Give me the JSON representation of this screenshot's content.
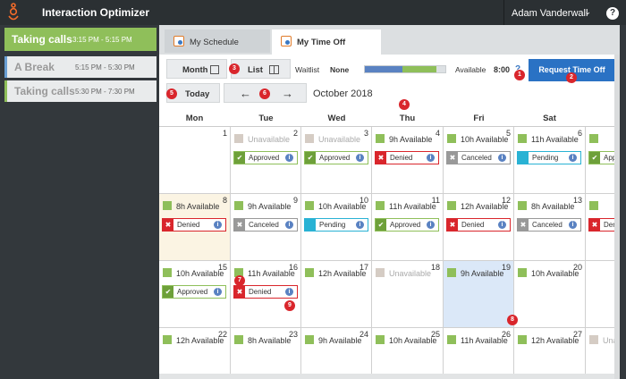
{
  "app": {
    "title": "Interaction Optimizer",
    "user": "Adam Vanderwall",
    "help": "?"
  },
  "sidebar": {
    "shifts": [
      {
        "name": "Taking calls",
        "time": "3:15 PM - 5:15 PM"
      },
      {
        "name": "A Break",
        "time": "5:15 PM - 5:30 PM"
      },
      {
        "name": "Taking calls",
        "time": "5:30 PM - 7:30 PM"
      }
    ]
  },
  "tabs": [
    {
      "label": "My Schedule"
    },
    {
      "label": "My Time Off"
    }
  ],
  "toolbar": {
    "month_label": "Month",
    "list_label": "List",
    "today_label": "Today",
    "prev_icon": "arrow-left-icon",
    "next_icon": "arrow-right-icon",
    "prev_glyph": "←",
    "next_glyph": "→",
    "current_month": "October 2018",
    "waitlist_label": "Waitlist",
    "waitlist_value": "None",
    "available_label": "Available",
    "available_value": "8:00",
    "help_glyph": "?",
    "request_button": "Request Time Off",
    "progress": {
      "blue_fraction": 0.47,
      "green_fraction": 0.42
    }
  },
  "badges": [
    "1",
    "2",
    "3",
    "4",
    "5",
    "6",
    "7",
    "8",
    "9"
  ],
  "calendar": {
    "days": [
      "Mon",
      "Tue",
      "Wed",
      "Thu",
      "Fri",
      "Sat",
      "Su"
    ],
    "weeks": [
      [
        {
          "day": "1",
          "avail": "",
          "status": ""
        },
        {
          "day": "2",
          "avail": "Unavailable",
          "unavailable": true,
          "status": "Approved"
        },
        {
          "day": "3",
          "avail": "Unavailable",
          "unavailable": true,
          "status": "Approved"
        },
        {
          "day": "4",
          "avail": "9h Available",
          "status": "Denied"
        },
        {
          "day": "5",
          "avail": "10h Available",
          "status": "Canceled"
        },
        {
          "day": "6",
          "avail": "11h Available",
          "status": "Pending"
        },
        {
          "day": "",
          "avail": "",
          "status": "Approved"
        }
      ],
      [
        {
          "day": "8",
          "avail": "8h Available",
          "status": "Denied",
          "today": true
        },
        {
          "day": "9",
          "avail": "9h Available",
          "status": "Canceled"
        },
        {
          "day": "10",
          "avail": "10h Available",
          "status": "Pending"
        },
        {
          "day": "11",
          "avail": "11h Available",
          "status": "Approved"
        },
        {
          "day": "12",
          "avail": "12h Available",
          "status": "Denied"
        },
        {
          "day": "13",
          "avail": "8h Available",
          "status": "Canceled"
        },
        {
          "day": "",
          "avail": "",
          "status": "Denied"
        }
      ],
      [
        {
          "day": "15",
          "avail": "10h Available",
          "status": "Approved"
        },
        {
          "day": "16",
          "avail": "11h Available",
          "status": "Denied"
        },
        {
          "day": "17",
          "avail": "12h Available",
          "status": ""
        },
        {
          "day": "18",
          "avail": "Unavailable",
          "unavailable": true,
          "status": ""
        },
        {
          "day": "19",
          "avail": "9h Available",
          "status": "",
          "selected": true
        },
        {
          "day": "20",
          "avail": "10h Available",
          "status": ""
        },
        {
          "day": "",
          "avail": "",
          "status": ""
        }
      ],
      [
        {
          "day": "22",
          "avail": "12h Available",
          "status": ""
        },
        {
          "day": "23",
          "avail": "8h Available",
          "status": ""
        },
        {
          "day": "24",
          "avail": "9h Available",
          "status": ""
        },
        {
          "day": "25",
          "avail": "10h Available",
          "status": ""
        },
        {
          "day": "26",
          "avail": "11h Available",
          "status": ""
        },
        {
          "day": "27",
          "avail": "12h Available",
          "status": ""
        },
        {
          "day": "",
          "avail": "Unav",
          "unavailable": true,
          "status": ""
        }
      ]
    ]
  },
  "colors": {
    "accent": "#2a72c4",
    "available": "#8fbf5a",
    "denied": "#d9262c",
    "pending": "#29b2d4",
    "canceled": "#999999",
    "badge": "#d9262c"
  }
}
